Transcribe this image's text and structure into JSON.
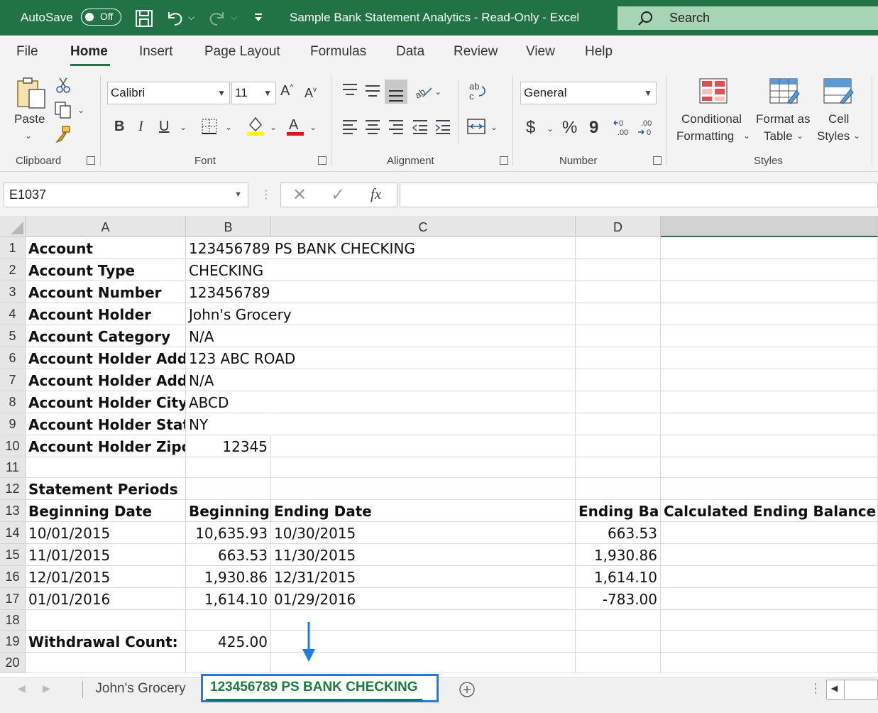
{
  "titlebar": {
    "autosave_label": "AutoSave",
    "autosave_state": "Off",
    "doc_title": "Sample Bank Statement Analytics  -  Read-Only  -  Excel",
    "search_placeholder": "Search"
  },
  "menu": {
    "items": [
      "File",
      "Home",
      "Insert",
      "Page Layout",
      "Formulas",
      "Data",
      "Review",
      "View",
      "Help"
    ],
    "active": "Home"
  },
  "ribbon": {
    "clipboard": {
      "paste_label": "Paste",
      "group_label": "Clipboard"
    },
    "font": {
      "font_name": "Calibri",
      "font_size": "11",
      "bold": "B",
      "italic": "I",
      "underline": "U",
      "group_label": "Font"
    },
    "alignment": {
      "group_label": "Alignment"
    },
    "number": {
      "format": "General",
      "currency": "$",
      "percent": "%",
      "comma": "9",
      "group_label": "Number"
    },
    "styles": {
      "conditional_line1": "Conditional",
      "conditional_line2": "Formatting",
      "format_table_line1": "Format as",
      "format_table_line2": "Table",
      "cell_styles_line1": "Cell",
      "cell_styles_line2": "Styles",
      "group_label": "Styles"
    },
    "colors": {
      "highlight": "#ffff00",
      "font_color": "#e81123"
    }
  },
  "formula_bar": {
    "name_box": "E1037",
    "formula": ""
  },
  "columns": [
    "A",
    "B",
    "C",
    "D"
  ],
  "rows": [
    {
      "n": "1",
      "a": "Account",
      "b": "123456789 PS BANK CHECKING",
      "c": "",
      "d": "",
      "e": ""
    },
    {
      "n": "2",
      "a": "Account Type",
      "b": "CHECKING",
      "c": "",
      "d": "",
      "e": ""
    },
    {
      "n": "3",
      "a": "Account Number",
      "b": " 123456789",
      "c": "",
      "d": "",
      "e": ""
    },
    {
      "n": "4",
      "a": "Account Holder",
      "b": "John's Grocery",
      "c": "",
      "d": "",
      "e": ""
    },
    {
      "n": "5",
      "a": "Account Category",
      "b": "N/A",
      "c": "",
      "d": "",
      "e": ""
    },
    {
      "n": "6",
      "a": "Account Holder Addre",
      "b": "123 ABC ROAD",
      "c": "",
      "d": "",
      "e": ""
    },
    {
      "n": "7",
      "a": "Account Holder Addre",
      "b": "N/A",
      "c": "",
      "d": "",
      "e": ""
    },
    {
      "n": "8",
      "a": "Account Holder City",
      "b": "ABCD",
      "c": "",
      "d": "",
      "e": ""
    },
    {
      "n": "9",
      "a": "Account Holder State",
      "b": "NY",
      "c": "",
      "d": "",
      "e": ""
    },
    {
      "n": "10",
      "a": "Account Holder Zipcoc",
      "b": "12345",
      "c": "",
      "d": "",
      "e": ""
    },
    {
      "n": "11",
      "a": "",
      "b": "",
      "c": "",
      "d": "",
      "e": ""
    },
    {
      "n": "12",
      "a": "Statement Periods",
      "b": "",
      "c": "",
      "d": "",
      "e": ""
    },
    {
      "n": "13",
      "a": "Beginning Date",
      "b": "Beginning B",
      "c": "Ending Date",
      "d": "Ending Bala",
      "e": "Calculated Ending Balance"
    },
    {
      "n": "14",
      "a": "10/01/2015",
      "b": "10,635.93",
      "c": "10/30/2015",
      "d": "663.53",
      "e": ""
    },
    {
      "n": "15",
      "a": "11/01/2015",
      "b": "663.53",
      "c": "11/30/2015",
      "d": "1,930.86",
      "e": ""
    },
    {
      "n": "16",
      "a": "12/01/2015",
      "b": "1,930.86",
      "c": "12/31/2015",
      "d": "1,614.10",
      "e": ""
    },
    {
      "n": "17",
      "a": "01/01/2016",
      "b": "1,614.10",
      "c": "01/29/2016",
      "d": "-783.00",
      "e": ""
    },
    {
      "n": "18",
      "a": "",
      "b": "",
      "c": "",
      "d": "",
      "e": ""
    },
    {
      "n": "19",
      "a": "Withdrawal Count:",
      "b": "425.00",
      "c": "",
      "d": "",
      "e": ""
    },
    {
      "n": "20",
      "a": "",
      "b": "",
      "c": "",
      "d": "",
      "e": ""
    }
  ],
  "sheet_tabs": {
    "inactive": "John's Grocery",
    "active": "123456789 PS BANK CHECKING"
  },
  "annotation": {
    "arrow_color": "#1e7ce0"
  }
}
